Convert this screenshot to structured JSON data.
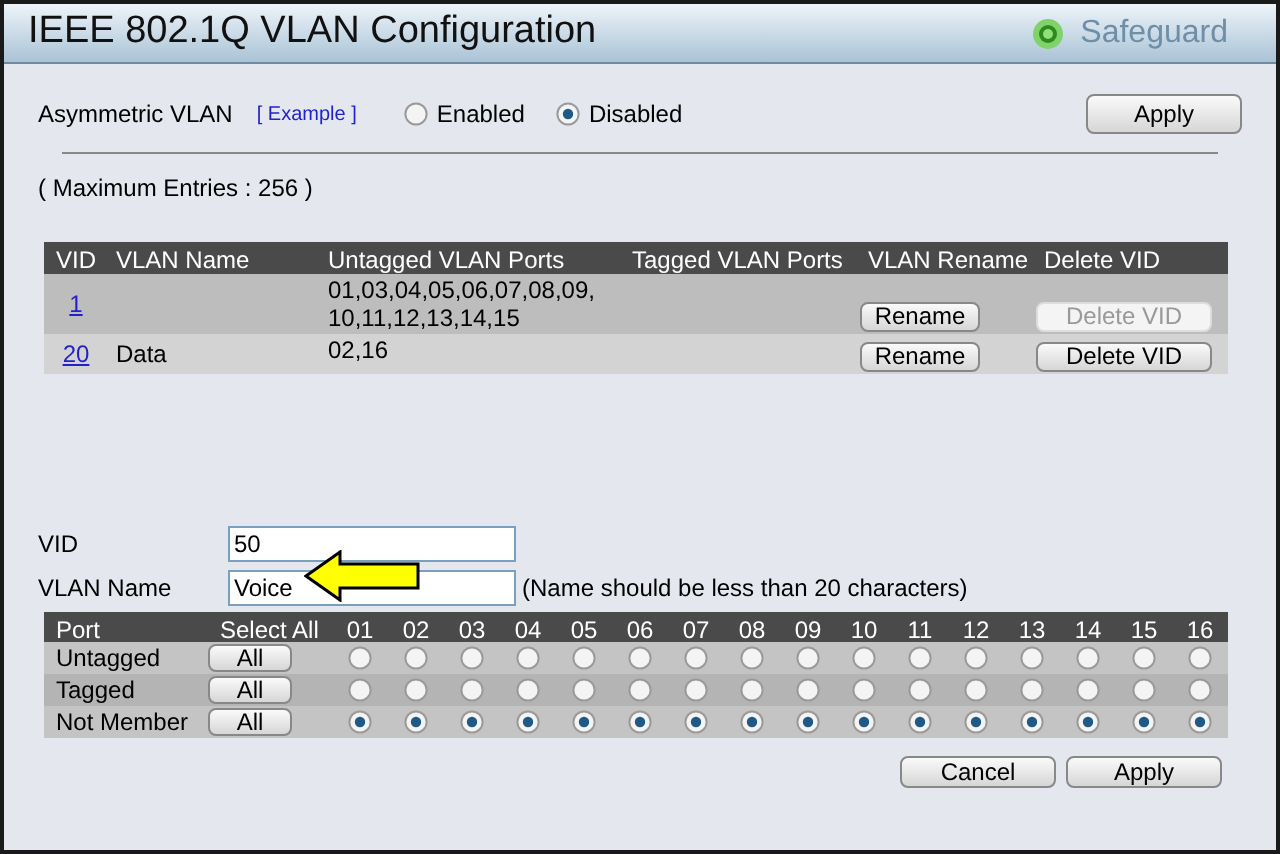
{
  "window": {
    "title": "IEEE 802.1Q VLAN Configuration",
    "brand": "Safeguard"
  },
  "asymmetric": {
    "label": "Asymmetric VLAN",
    "example_link": "[ Example ]",
    "options": [
      {
        "label": "Enabled",
        "selected": false
      },
      {
        "label": "Disabled",
        "selected": true
      }
    ],
    "apply": "Apply"
  },
  "max_entries": "( Maximum Entries : 256 )",
  "vlan_table": {
    "columns": [
      "VID",
      "VLAN Name",
      "Untagged VLAN Ports",
      "Tagged VLAN Ports",
      "VLAN Rename",
      "Delete VID"
    ],
    "rows": [
      {
        "vid": "1",
        "name": "",
        "untagged": "01,03,04,05,06,07,08,09,\n10,11,12,13,14,15",
        "tagged": "",
        "rename": "Rename",
        "delete": "Delete VID",
        "delete_disabled": true
      },
      {
        "vid": "20",
        "name": "Data",
        "untagged": "02,16",
        "tagged": "",
        "rename": "Rename",
        "delete": "Delete VID",
        "delete_disabled": false
      }
    ]
  },
  "form": {
    "vid_label": "VID",
    "vid_value": "50",
    "name_label": "VLAN Name",
    "name_value": "Voice",
    "name_hint": "(Name should be less than 20 characters)"
  },
  "port_table": {
    "columns": [
      "Port",
      "Select All"
    ],
    "ports": [
      "01",
      "02",
      "03",
      "04",
      "05",
      "06",
      "07",
      "08",
      "09",
      "10",
      "11",
      "12",
      "13",
      "14",
      "15",
      "16"
    ],
    "rows": [
      {
        "label": "Untagged",
        "button": "All",
        "cells": [
          {
            "selected": false
          },
          {
            "selected": false
          },
          {
            "selected": false
          },
          {
            "selected": false
          },
          {
            "selected": false
          },
          {
            "selected": false
          },
          {
            "selected": false
          },
          {
            "selected": false
          },
          {
            "selected": false
          },
          {
            "selected": false
          },
          {
            "selected": false
          },
          {
            "selected": false
          },
          {
            "selected": false
          },
          {
            "selected": false
          },
          {
            "selected": false
          },
          {
            "selected": false
          }
        ]
      },
      {
        "label": "Tagged",
        "button": "All",
        "cells": [
          {
            "selected": false
          },
          {
            "selected": false
          },
          {
            "selected": false
          },
          {
            "selected": false
          },
          {
            "selected": false
          },
          {
            "selected": false
          },
          {
            "selected": false
          },
          {
            "selected": false
          },
          {
            "selected": false
          },
          {
            "selected": false
          },
          {
            "selected": false
          },
          {
            "selected": false
          },
          {
            "selected": false
          },
          {
            "selected": false
          },
          {
            "selected": false
          },
          {
            "selected": false
          }
        ]
      },
      {
        "label": "Not Member",
        "button": "All",
        "cells": [
          {
            "selected": true
          },
          {
            "selected": true
          },
          {
            "selected": true
          },
          {
            "selected": true
          },
          {
            "selected": true
          },
          {
            "selected": true
          },
          {
            "selected": true
          },
          {
            "selected": true
          },
          {
            "selected": true
          },
          {
            "selected": true
          },
          {
            "selected": true
          },
          {
            "selected": true
          },
          {
            "selected": true
          },
          {
            "selected": true
          },
          {
            "selected": true
          },
          {
            "selected": true
          }
        ]
      }
    ]
  },
  "buttons": [
    "Cancel",
    "Apply"
  ]
}
